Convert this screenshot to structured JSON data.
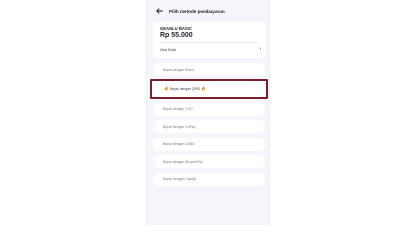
{
  "header": {
    "title": "Pilih metode pembayaran"
  },
  "package": {
    "name": "GEANLU BASIC",
    "price": "Rp 55.000",
    "details_label": "Lihat Detail"
  },
  "payment_methods": [
    {
      "label": "Bayar dengan Ruma",
      "selected": false
    },
    {
      "label": "Bayar dengan QRIS",
      "selected": true,
      "icon": "fire-icon"
    },
    {
      "label": "Bayar dengan OVO",
      "selected": false
    },
    {
      "label": "Bayar dengan GoPay",
      "selected": false
    },
    {
      "label": "Bayar dengan DANA",
      "selected": false
    },
    {
      "label": "Bayar dengan ShopeePay",
      "selected": false
    },
    {
      "label": "Bayar dengan LinkAja",
      "selected": false
    }
  ],
  "colors": {
    "background": "#f4f6fb",
    "selected_border": "#7a1f2a",
    "flame": "#e8742a"
  }
}
